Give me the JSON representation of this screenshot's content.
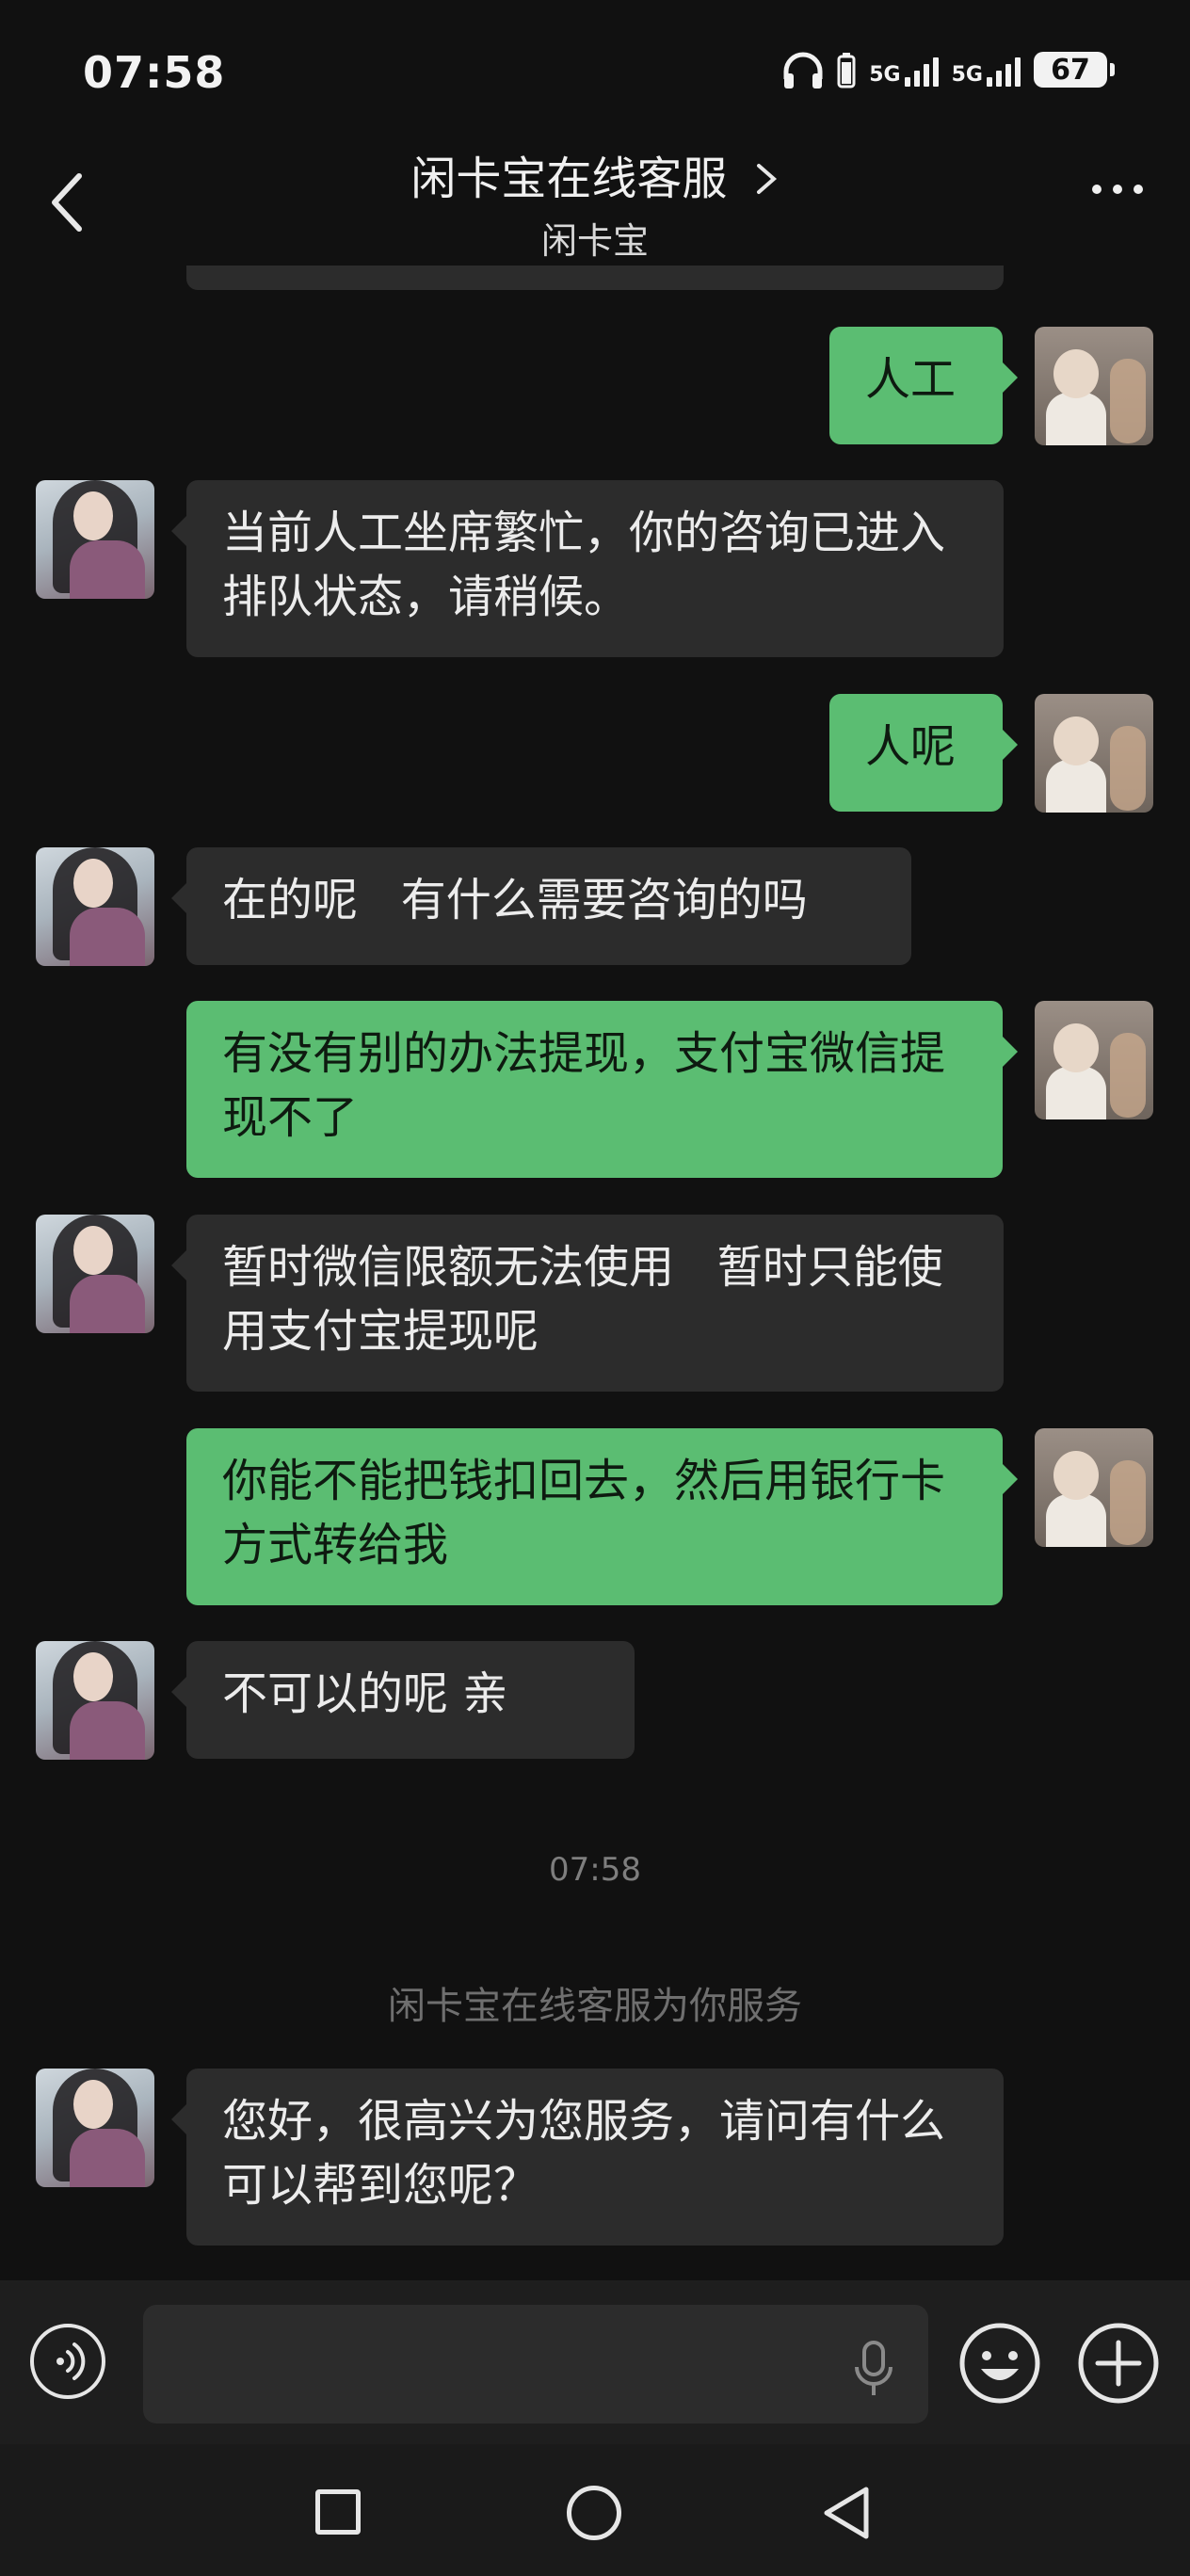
{
  "status_bar": {
    "time": "07:58",
    "net1": "5G",
    "net2": "5G",
    "battery": "67"
  },
  "header": {
    "title": "闲卡宝在线客服",
    "subtitle": "闲卡宝"
  },
  "messages": [
    {
      "from": "user",
      "text": "人工"
    },
    {
      "from": "agent",
      "text": "当前人工坐席繁忙，你的咨询已进入排队状态，请稍候。"
    },
    {
      "from": "user",
      "text": "人呢"
    },
    {
      "from": "agent",
      "text": "在的呢   有什么需要咨询的吗"
    },
    {
      "from": "user",
      "text": "有没有别的办法提现，支付宝微信提现不了"
    },
    {
      "from": "agent",
      "text": "暂时微信限额无法使用   暂时只能使用支付宝提现呢"
    },
    {
      "from": "user",
      "text": "你能不能把钱扣回去，然后用银行卡方式转给我"
    },
    {
      "from": "agent",
      "text": "不可以的呢 亲"
    },
    {
      "from": "agent",
      "text": "您好，很高兴为您服务，请问有什么可以帮到您呢？"
    }
  ],
  "timestamp": "07:58",
  "system_notice": "闲卡宝在线客服为你服务",
  "input": {
    "value": "",
    "placeholder": ""
  },
  "colors": {
    "background": "#111111",
    "outgoing_bubble": "#5bbd72",
    "incoming_bubble": "#2c2c2c"
  }
}
